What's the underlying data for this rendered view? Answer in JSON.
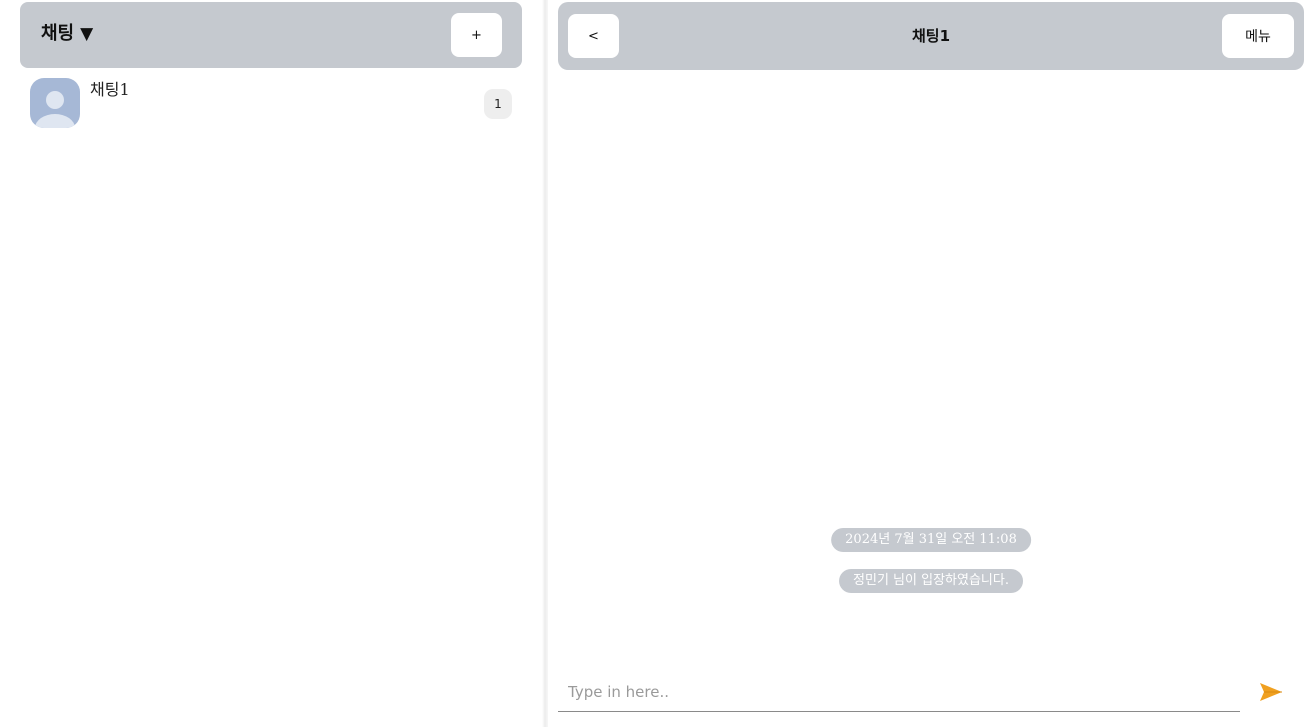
{
  "sidebar": {
    "title": "채팅",
    "title_caret": "▼",
    "add_label": "+",
    "rooms": [
      {
        "name": "채팅1",
        "unread": "1",
        "avatar_icon": "default-user-avatar"
      }
    ]
  },
  "chat": {
    "back_label": "<",
    "title": "채팅1",
    "menu_label": "메뉴",
    "system_messages": [
      "2024년 7월 31일 오전 11:08",
      "정민기 님이 입장하였습니다."
    ],
    "input_placeholder": "Type in here..",
    "input_value": "",
    "send_icon": "send-arrow-icon"
  },
  "colors": {
    "header_bg": "#c5c9cf",
    "avatar_bg": "#a6b8d6",
    "send_accent": "#f0a020",
    "badge_bg": "#eeeeee"
  }
}
